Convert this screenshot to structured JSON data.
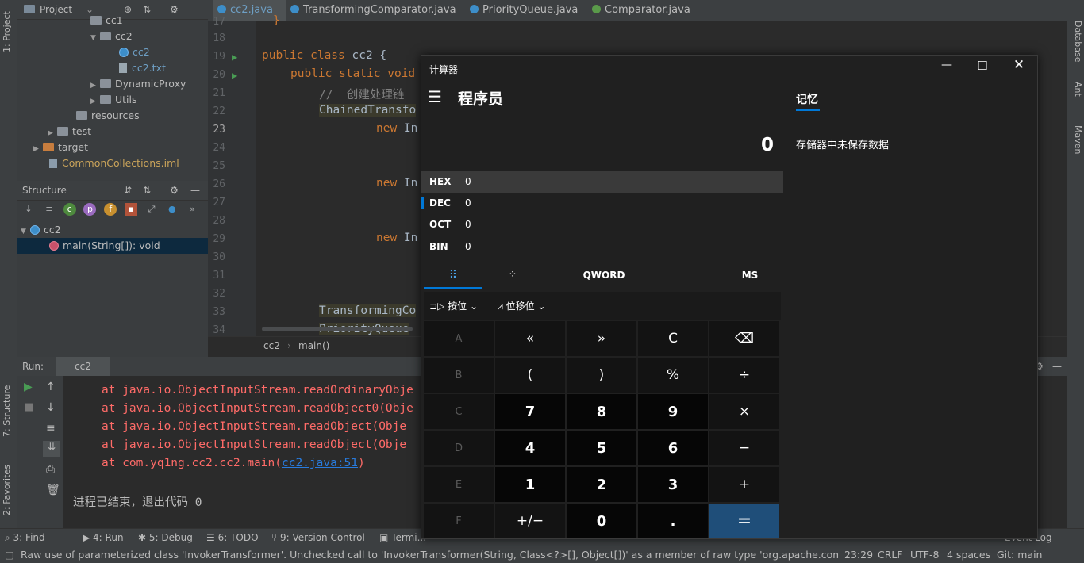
{
  "left_strip": {
    "project_tab": "1: Project",
    "structure_tab": "7: Structure",
    "favorites_tab": "2: Favorites"
  },
  "right_strip": {
    "database_tab": "Database",
    "ant_tab": "Ant",
    "maven_tab": "Maven"
  },
  "project_panel": {
    "title": "Project",
    "items": [
      {
        "label": "cc1",
        "kind": "folder"
      },
      {
        "label": "cc2",
        "kind": "folder"
      },
      {
        "label": "cc2",
        "kind": "class"
      },
      {
        "label": "cc2.txt",
        "kind": "file"
      },
      {
        "label": "DynamicProxy",
        "kind": "folder"
      },
      {
        "label": "Utils",
        "kind": "folder"
      },
      {
        "label": "resources",
        "kind": "folder"
      },
      {
        "label": "test",
        "kind": "folder"
      },
      {
        "label": "target",
        "kind": "folder-excluded"
      },
      {
        "label": "CommonCollections.iml",
        "kind": "iml"
      }
    ]
  },
  "structure_panel": {
    "title": "Structure",
    "class_name": "cc2",
    "method": "main(String[]): void"
  },
  "editor_tabs": [
    {
      "label": "cc2.java",
      "active": true
    },
    {
      "label": "TransformingComparator.java",
      "active": false
    },
    {
      "label": "PriorityQueue.java",
      "active": false
    },
    {
      "label": "Comparator.java",
      "active": false
    }
  ],
  "editor": {
    "line_numbers": [
      "17",
      "18",
      "19",
      "20",
      "21",
      "22",
      "23",
      "24",
      "25",
      "26",
      "27",
      "28",
      "29",
      "30",
      "31",
      "32",
      "33",
      "34"
    ],
    "lines": {
      "l17": "}",
      "l19_kw": "public class",
      "l19_rest": " cc2 {",
      "l20_kw": "public static void",
      "l21_comment": "//  创建处理链",
      "l22": "ChainedTransfo",
      "l23_kw": "new",
      "l23_rest": " In",
      "l26_kw": "new",
      "l26_rest": " In",
      "l29_kw": "new",
      "l29_rest": " In",
      "l33": "TransformingCo",
      "l34": "PriorityQueue"
    },
    "breadcrumb": [
      "cc2",
      "main()"
    ]
  },
  "run_panel": {
    "label": "Run:",
    "tab": "cc2",
    "console_lines": [
      "at java.io.ObjectInputStream.readOrdinaryObje",
      "at java.io.ObjectInputStream.readObject0(Obje",
      "at java.io.ObjectInputStream.readObject(Obje",
      "at java.io.ObjectInputStream.readObject(Obje"
    ],
    "last_trace_prefix": "at com.yq1ng.cc2.cc2.main(",
    "last_trace_link": "cc2.java:51",
    "last_trace_suffix": ")",
    "exit_message": "进程已结束，退出代码 0"
  },
  "bottom_tools": {
    "find": "3: Find",
    "run": "4: Run",
    "debug": "5: Debug",
    "todo": "6: TODO",
    "vcs": "9: Version Control",
    "terminal": "Termi...",
    "event_log": "Event Log"
  },
  "status_bar": {
    "message": "Raw use of parameterized class 'InvokerTransformer'. Unchecked call to 'InvokerTransformer(String, Class<?>[], Object[])' as a member of raw type 'org.apache.commons.colle...",
    "position": "23:29",
    "line_sep": "CRLF",
    "encoding": "UTF-8",
    "indent": "4 spaces",
    "git": "Git: main"
  },
  "calculator": {
    "window_title": "计算器",
    "mode_title": "程序员",
    "display_value": "0",
    "radix": [
      {
        "name": "HEX",
        "value": "0"
      },
      {
        "name": "DEC",
        "value": "0"
      },
      {
        "name": "OCT",
        "value": "0"
      },
      {
        "name": "BIN",
        "value": "0"
      }
    ],
    "word_size": "QWORD",
    "ms_label": "MS",
    "bitwise_label": "按位",
    "bitshift_label": "位移位",
    "memory_title": "记忆",
    "memory_empty": "存储器中未保存数据",
    "keys": [
      [
        "A",
        "«",
        "»",
        "C",
        "⌫"
      ],
      [
        "B",
        "(",
        ")",
        "%",
        "÷"
      ],
      [
        "C",
        "7",
        "8",
        "9",
        "×"
      ],
      [
        "D",
        "4",
        "5",
        "6",
        "−"
      ],
      [
        "E",
        "1",
        "2",
        "3",
        "+"
      ],
      [
        "F",
        "+/−",
        "0",
        ".",
        "="
      ]
    ],
    "accent_color": "#0078d7"
  }
}
